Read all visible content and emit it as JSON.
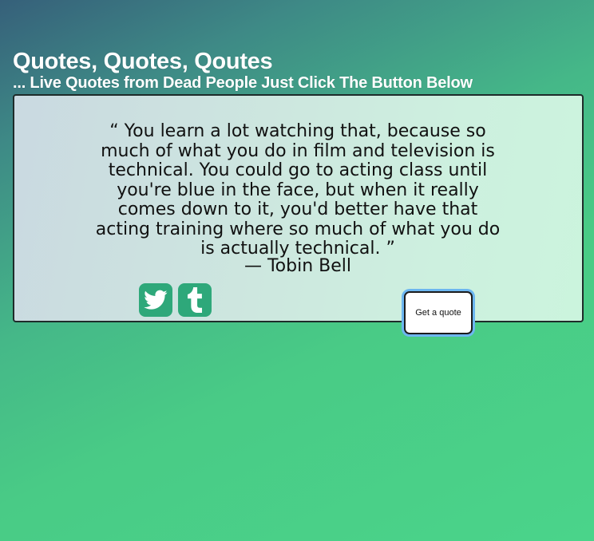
{
  "header": {
    "title": "Quotes, Quotes, Qoutes",
    "subtitle": "... Live Quotes from Dead People Just Click The Button Below"
  },
  "quote": {
    "text": "“ You learn a lot watching that, because so much of what you do in film and television is technical. You could go to acting class until you're blue in the face, but when it really comes down to it, you'd better have that acting training where so much of what you do is actually technical. ”",
    "author": "— Tobin Bell"
  },
  "share": {
    "twitter_icon": "twitter-icon",
    "tumblr_icon": "tumblr-icon",
    "icon_color": "#2ea87a"
  },
  "actions": {
    "get_quote_label": "Get a quote"
  },
  "colors": {
    "background_start": "#36607a",
    "background_end": "#4ad48a",
    "focus_ring": "#6cb6f0"
  }
}
